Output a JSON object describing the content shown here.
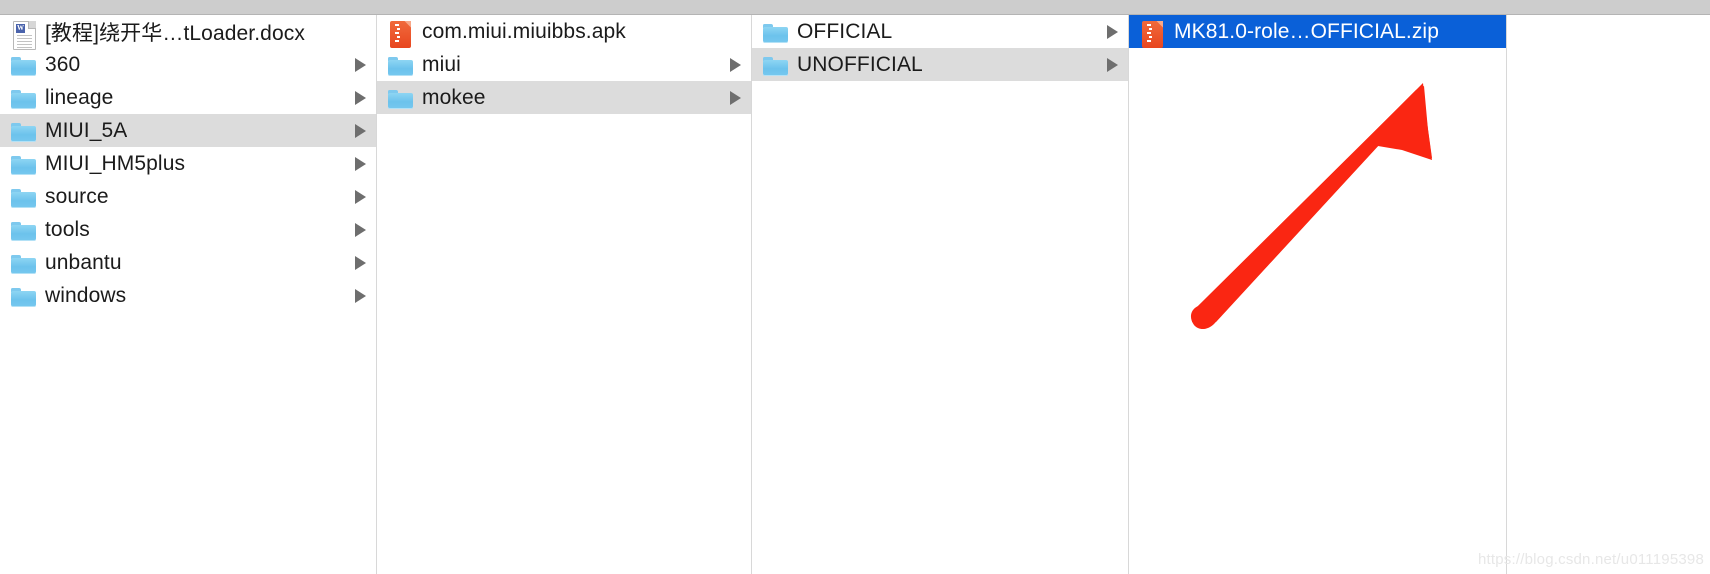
{
  "window": {
    "app": "Finder",
    "view_mode": "column"
  },
  "columns": [
    {
      "id": "column-1",
      "items": [
        {
          "label": "[教程]绕开华…tLoader.docx",
          "icon": "word-document-icon",
          "has_disclosure": false,
          "state": "normal"
        },
        {
          "label": "360",
          "icon": "folder-icon",
          "has_disclosure": true,
          "state": "normal"
        },
        {
          "label": "lineage",
          "icon": "folder-icon",
          "has_disclosure": true,
          "state": "normal"
        },
        {
          "label": "MIUI_5A",
          "icon": "folder-icon",
          "has_disclosure": true,
          "state": "selected-inactive"
        },
        {
          "label": "MIUI_HM5plus",
          "icon": "folder-icon",
          "has_disclosure": true,
          "state": "normal"
        },
        {
          "label": "source",
          "icon": "folder-icon",
          "has_disclosure": true,
          "state": "normal"
        },
        {
          "label": "tools",
          "icon": "folder-icon",
          "has_disclosure": true,
          "state": "normal"
        },
        {
          "label": "unbantu",
          "icon": "folder-icon",
          "has_disclosure": true,
          "state": "normal"
        },
        {
          "label": "windows",
          "icon": "folder-icon",
          "has_disclosure": true,
          "state": "normal"
        }
      ]
    },
    {
      "id": "column-2",
      "items": [
        {
          "label": "com.miui.miuibbs.apk",
          "icon": "archive-icon",
          "has_disclosure": false,
          "state": "normal"
        },
        {
          "label": "miui",
          "icon": "folder-icon",
          "has_disclosure": true,
          "state": "normal"
        },
        {
          "label": "mokee",
          "icon": "folder-icon",
          "has_disclosure": true,
          "state": "selected-inactive"
        }
      ]
    },
    {
      "id": "column-3",
      "items": [
        {
          "label": "OFFICIAL",
          "icon": "folder-icon",
          "has_disclosure": true,
          "state": "normal"
        },
        {
          "label": "UNOFFICIAL",
          "icon": "folder-icon",
          "has_disclosure": true,
          "state": "selected-inactive"
        }
      ]
    },
    {
      "id": "column-4",
      "items": [
        {
          "label": "MK81.0-role…OFFICIAL.zip",
          "icon": "archive-icon",
          "has_disclosure": false,
          "state": "selected-active"
        }
      ]
    },
    {
      "id": "column-5",
      "items": []
    }
  ],
  "annotation": {
    "type": "arrow",
    "color": "#fa2612",
    "points_to": "MK81.0-role…OFFICIAL.zip"
  },
  "watermark": {
    "text": "https://blog.csdn.net/u011195398",
    "color": "#e7e7e7"
  },
  "colors": {
    "selection_active": "#0a60d8",
    "selection_inactive": "#dcdcdc",
    "folder": "#76c8ef",
    "archive": "#e8461f",
    "chrome": "#cdcdcd",
    "divider": "#d8d8d8"
  }
}
